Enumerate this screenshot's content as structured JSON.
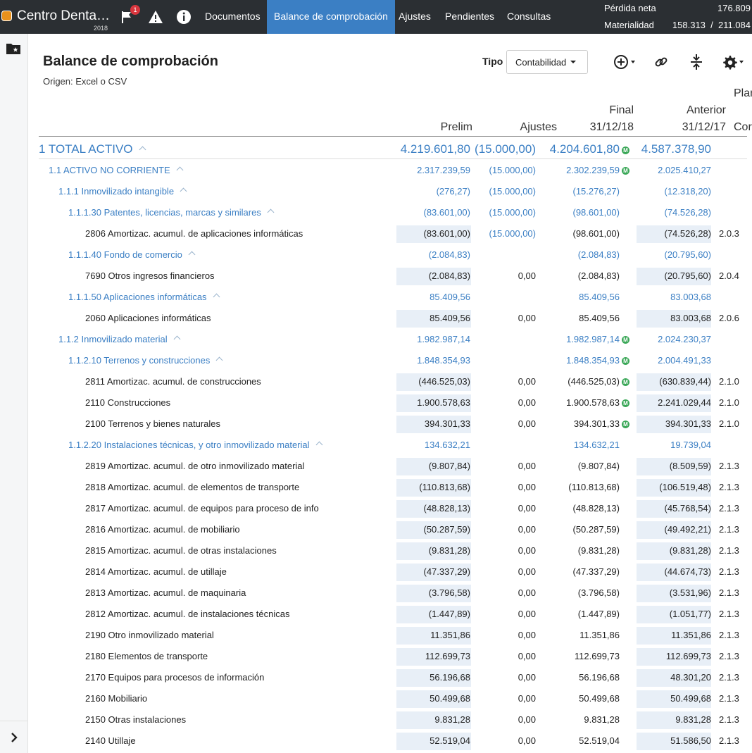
{
  "header": {
    "company": "Centro Denta…",
    "year": "2018",
    "flag_badge": "1",
    "nav": [
      "Documentos",
      "Balance de comprobación",
      "Ajustes",
      "Pendientes",
      "Consultas"
    ],
    "active_nav": "Balance de comprobación",
    "summary": [
      {
        "label": "Pérdida neta",
        "value": "176.809"
      },
      {
        "label": "Materialidad",
        "value": "158.313  /  211.084"
      }
    ]
  },
  "page": {
    "title": "Balance de comprobación",
    "subtitle": "Origen: Excel o CSV",
    "tipo_label": "Tipo",
    "tipo_value": "Contabilidad"
  },
  "columns": {
    "prelim": "Prelim",
    "ajustes": "Ajustes",
    "final_top": "Final",
    "final_date": "31/12/18",
    "anterior_top": "Anterior",
    "anterior_date": "31/12/17",
    "plan_top": "Plan",
    "plan_bottom": "Cor"
  },
  "rows": [
    {
      "level": 0,
      "label": "1 TOTAL ACTIVO",
      "group": true,
      "prelim": "4.219.601,80",
      "ajustes": "(15.000,00)",
      "final": "4.204.601,80",
      "final_m": true,
      "anterior": "4.587.378,90",
      "plan": ""
    },
    {
      "level": 1,
      "label": "1.1 ACTIVO NO CORRIENTE",
      "group": true,
      "prelim": "2.317.239,59",
      "ajustes": "(15.000,00)",
      "final": "2.302.239,59",
      "final_m": true,
      "anterior": "2.025.410,27",
      "plan": ""
    },
    {
      "level": 2,
      "label": "1.1.1 Inmovilizado intangible",
      "group": true,
      "prelim": "(276,27)",
      "ajustes": "(15.000,00)",
      "final": "(15.276,27)",
      "final_m": false,
      "anterior": "(12.318,20)",
      "plan": ""
    },
    {
      "level": 3,
      "label": "1.1.1.30 Patentes, licencias, marcas y similares",
      "group": true,
      "prelim": "(83.601,00)",
      "ajustes": "(15.000,00)",
      "final": "(98.601,00)",
      "final_m": false,
      "anterior": "(74.526,28)",
      "plan": ""
    },
    {
      "level": 4,
      "label": "2806 Amortizac. acumul. de aplicaciones informáticas",
      "group": false,
      "prelim": "(83.601,00)",
      "ajustes": "(15.000,00)",
      "ajustes_blue": true,
      "final": "(98.601,00)",
      "final_m": false,
      "anterior": "(74.526,28)",
      "plan": "2.0.3"
    },
    {
      "level": 3,
      "label": "1.1.1.40 Fondo de comercio",
      "group": true,
      "prelim": "(2.084,83)",
      "ajustes": "",
      "final": "(2.084,83)",
      "final_m": false,
      "anterior": "(20.795,60)",
      "plan": ""
    },
    {
      "level": 4,
      "label": "7690 Otros ingresos financieros",
      "group": false,
      "prelim": "(2.084,83)",
      "ajustes": "0,00",
      "final": "(2.084,83)",
      "final_m": false,
      "anterior": "(20.795,60)",
      "plan": "2.0.4"
    },
    {
      "level": 3,
      "label": "1.1.1.50 Aplicaciones informáticas",
      "group": true,
      "prelim": "85.409,56",
      "ajustes": "",
      "final": "85.409,56",
      "final_m": false,
      "anterior": "83.003,68",
      "plan": ""
    },
    {
      "level": 4,
      "label": "2060 Aplicaciones informáticas",
      "group": false,
      "prelim": "85.409,56",
      "ajustes": "0,00",
      "final": "85.409,56",
      "final_m": false,
      "anterior": "83.003,68",
      "plan": "2.0.6"
    },
    {
      "level": 2,
      "label": "1.1.2 Inmovilizado material",
      "group": true,
      "prelim": "1.982.987,14",
      "ajustes": "",
      "final": "1.982.987,14",
      "final_m": true,
      "anterior": "2.024.230,37",
      "plan": ""
    },
    {
      "level": 3,
      "label": "1.1.2.10 Terrenos y construcciones",
      "group": true,
      "prelim": "1.848.354,93",
      "ajustes": "",
      "final": "1.848.354,93",
      "final_m": true,
      "anterior": "2.004.491,33",
      "plan": ""
    },
    {
      "level": 4,
      "label": "2811 Amortizac. acumul. de construcciones",
      "group": false,
      "prelim": "(446.525,03)",
      "ajustes": "0,00",
      "final": "(446.525,03)",
      "final_m": true,
      "anterior": "(630.839,44)",
      "plan": "2.1.0"
    },
    {
      "level": 4,
      "label": "2110 Construcciones",
      "group": false,
      "prelim": "1.900.578,63",
      "ajustes": "0,00",
      "final": "1.900.578,63",
      "final_m": true,
      "anterior": "2.241.029,44",
      "plan": "2.1.0"
    },
    {
      "level": 4,
      "label": "2100 Terrenos y bienes naturales",
      "group": false,
      "prelim": "394.301,33",
      "ajustes": "0,00",
      "final": "394.301,33",
      "final_m": true,
      "anterior": "394.301,33",
      "plan": "2.1.0"
    },
    {
      "level": 3,
      "label": "1.1.2.20 Instalaciones técnicas, y otro inmovilizado material",
      "group": true,
      "prelim": "134.632,21",
      "ajustes": "",
      "final": "134.632,21",
      "final_m": false,
      "anterior": "19.739,04",
      "plan": ""
    },
    {
      "level": 4,
      "label": "2819 Amortizac. acumul. de otro inmovilizado material",
      "group": false,
      "prelim": "(9.807,84)",
      "ajustes": "0,00",
      "final": "(9.807,84)",
      "final_m": false,
      "anterior": "(8.509,59)",
      "plan": "2.1.3"
    },
    {
      "level": 4,
      "label": "2818 Amortizac. acumul. de elementos de transporte",
      "group": false,
      "prelim": "(110.813,68)",
      "ajustes": "0,00",
      "final": "(110.813,68)",
      "final_m": false,
      "anterior": "(106.519,48)",
      "plan": "2.1.3"
    },
    {
      "level": 4,
      "label": "2817 Amortizac. acumul. de equipos para proceso de info",
      "group": false,
      "prelim": "(48.828,13)",
      "ajustes": "0,00",
      "final": "(48.828,13)",
      "final_m": false,
      "anterior": "(45.768,54)",
      "plan": "2.1.3"
    },
    {
      "level": 4,
      "label": "2816 Amortizac. acumul. de mobiliario",
      "group": false,
      "prelim": "(50.287,59)",
      "ajustes": "0,00",
      "final": "(50.287,59)",
      "final_m": false,
      "anterior": "(49.492,21)",
      "plan": "2.1.3"
    },
    {
      "level": 4,
      "label": "2815 Amortizac. acumul. de otras instalaciones",
      "group": false,
      "prelim": "(9.831,28)",
      "ajustes": "0,00",
      "final": "(9.831,28)",
      "final_m": false,
      "anterior": "(9.831,28)",
      "plan": "2.1.3"
    },
    {
      "level": 4,
      "label": "2814 Amortizac. acumul. de utillaje",
      "group": false,
      "prelim": "(47.337,29)",
      "ajustes": "0,00",
      "final": "(47.337,29)",
      "final_m": false,
      "anterior": "(44.674,73)",
      "plan": "2.1.3"
    },
    {
      "level": 4,
      "label": "2813 Amortizac. acumul. de maquinaria",
      "group": false,
      "prelim": "(3.796,58)",
      "ajustes": "0,00",
      "final": "(3.796,58)",
      "final_m": false,
      "anterior": "(3.531,96)",
      "plan": "2.1.3"
    },
    {
      "level": 4,
      "label": "2812 Amortizac. acumul. de instalaciones técnicas",
      "group": false,
      "prelim": "(1.447,89)",
      "ajustes": "0,00",
      "final": "(1.447,89)",
      "final_m": false,
      "anterior": "(1.051,77)",
      "plan": "2.1.3"
    },
    {
      "level": 4,
      "label": "2190 Otro inmovilizado material",
      "group": false,
      "prelim": "11.351,86",
      "ajustes": "0,00",
      "final": "11.351,86",
      "final_m": false,
      "anterior": "11.351,86",
      "plan": "2.1.3"
    },
    {
      "level": 4,
      "label": "2180 Elementos de transporte",
      "group": false,
      "prelim": "112.699,73",
      "ajustes": "0,00",
      "final": "112.699,73",
      "final_m": false,
      "anterior": "112.699,73",
      "plan": "2.1.3"
    },
    {
      "level": 4,
      "label": "2170 Equipos para procesos de información",
      "group": false,
      "prelim": "56.196,68",
      "ajustes": "0,00",
      "final": "56.196,68",
      "final_m": false,
      "anterior": "48.301,20",
      "plan": "2.1.3"
    },
    {
      "level": 4,
      "label": "2160 Mobiliario",
      "group": false,
      "prelim": "50.499,68",
      "ajustes": "0,00",
      "final": "50.499,68",
      "final_m": false,
      "anterior": "50.499,68",
      "plan": "2.1.3"
    },
    {
      "level": 4,
      "label": "2150 Otras instalaciones",
      "group": false,
      "prelim": "9.831,28",
      "ajustes": "0,00",
      "final": "9.831,28",
      "final_m": false,
      "anterior": "9.831,28",
      "plan": "2.1.3"
    },
    {
      "level": 4,
      "label": "2140 Utillaje",
      "group": false,
      "prelim": "52.519,04",
      "ajustes": "0,00",
      "final": "52.519,04",
      "final_m": false,
      "anterior": "51.586,50",
      "plan": "2.1.3"
    }
  ],
  "badge_letter": "M",
  "colors": {
    "topbar": "#2b2f33",
    "accent": "#3b7fc4",
    "badge": "#3aa757",
    "shade": "#e8eff7"
  }
}
